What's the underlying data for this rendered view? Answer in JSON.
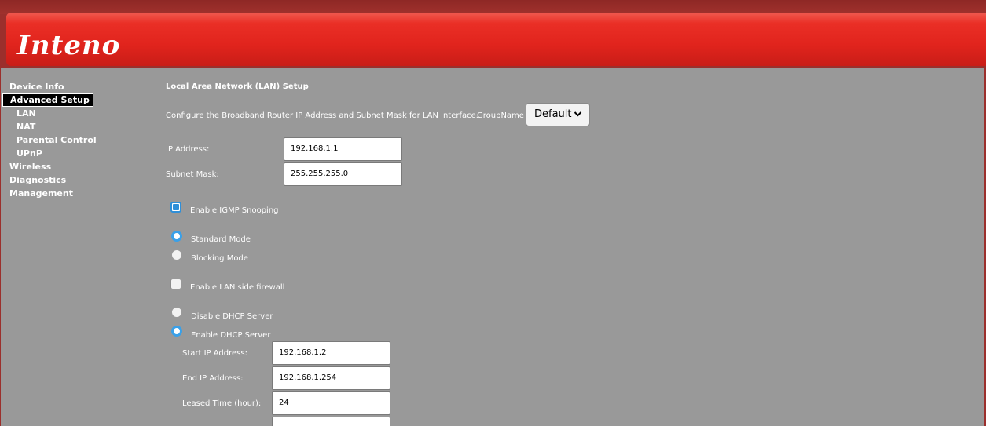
{
  "brand": {
    "logo_text": "Inteno"
  },
  "sidebar": {
    "items": [
      {
        "label": "Device Info"
      },
      {
        "label": "Advanced Setup"
      },
      {
        "label": "LAN"
      },
      {
        "label": "NAT"
      },
      {
        "label": "Parental Control"
      },
      {
        "label": "UPnP"
      },
      {
        "label": "Wireless"
      },
      {
        "label": "Diagnostics"
      },
      {
        "label": "Management"
      }
    ]
  },
  "main": {
    "title": "Local Area Network (LAN) Setup",
    "description": "Configure the Broadband Router IP Address and Subnet Mask for LAN interface.",
    "group_label": "GroupName",
    "group_value": "Default",
    "ip_label": "IP Address:",
    "ip_value": "192.168.1.1",
    "mask_label": "Subnet Mask:",
    "mask_value": "255.255.255.0",
    "igmp_label": "Enable IGMP Snooping",
    "igmp_checked": true,
    "standard_label": "Standard Mode",
    "blocking_label": "Blocking Mode",
    "firewall_label": "Enable LAN side firewall",
    "firewall_checked": false,
    "disable_dhcp_label": "Disable DHCP Server",
    "enable_dhcp_label": "Enable DHCP Server",
    "start_ip_label": "Start IP Address:",
    "start_ip_value": "192.168.1.2",
    "end_ip_label": "End IP Address:",
    "end_ip_value": "192.168.1.254",
    "lease_label": "Leased Time (hour):",
    "lease_value": "24",
    "next_value": ""
  }
}
